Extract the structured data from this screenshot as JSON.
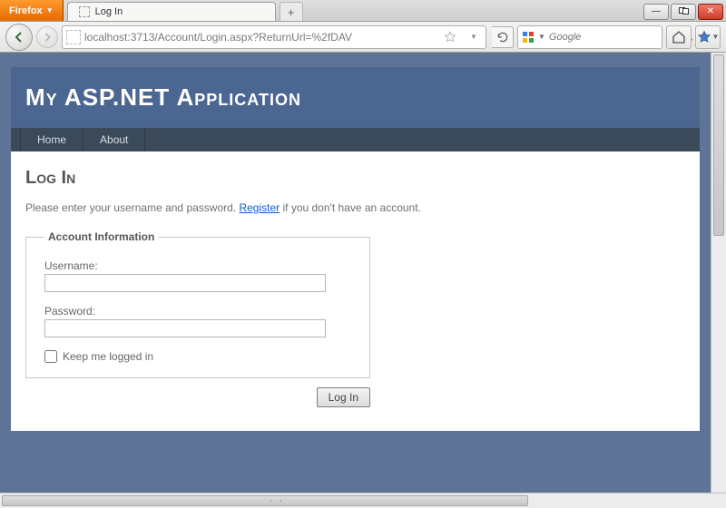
{
  "browser": {
    "app_button": "Firefox",
    "tab_title": "Log In",
    "newtab_symbol": "+",
    "url": "localhost:3713/Account/Login.aspx?ReturnUrl=%2fDAV",
    "search_placeholder": "Google",
    "win": {
      "min": "—",
      "close": "✕"
    }
  },
  "page": {
    "site_title": "My ASP.NET Application",
    "nav": {
      "home": "Home",
      "about": "About"
    },
    "heading": "Log In",
    "intro_pre": "Please enter your username and password. ",
    "intro_link": "Register",
    "intro_post": " if you don't have an account.",
    "fieldset_legend": "Account Information",
    "labels": {
      "username": "Username:",
      "password": "Password:",
      "keep": "Keep me logged in"
    },
    "values": {
      "username": "",
      "password": "",
      "keep": false
    },
    "submit": "Log In"
  }
}
